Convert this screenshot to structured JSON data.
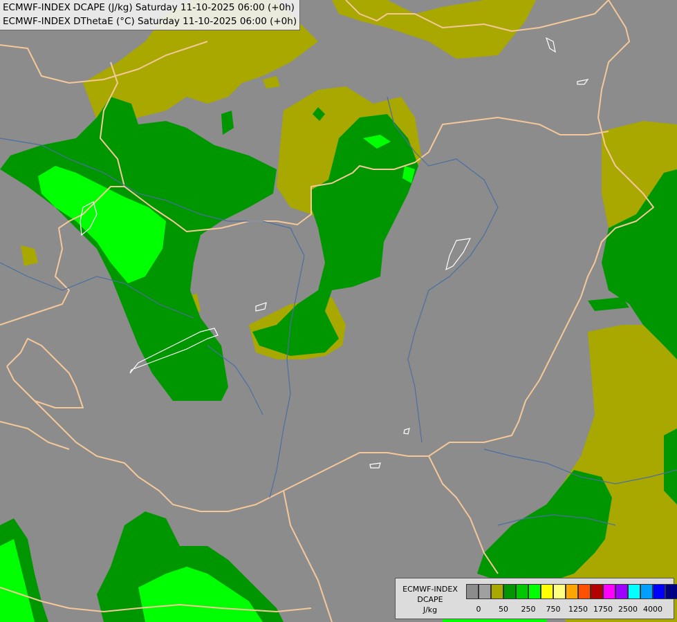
{
  "title": {
    "line1": "ECMWF-INDEX DCAPE (J/kg) Saturday 11-10-2025 06:00 (+0h)",
    "line2": "ECMWF-INDEX DThetaE (°C) Saturday 11-10-2025 06:00 (+0h)"
  },
  "legend": {
    "name": "ECMWF-INDEX",
    "variable": "DCAPE",
    "unit": "J/kg",
    "colors": [
      "#8c8c8c",
      "#a0a0a0",
      "#a8a800",
      "#009600",
      "#00c800",
      "#00ff00",
      "#ffff00",
      "#ffff80",
      "#ffa500",
      "#ff5000",
      "#b40000",
      "#ff00ff",
      "#a000ff",
      "#00ffff",
      "#00a0ff",
      "#0000ff",
      "#000080"
    ],
    "ticks": [
      "0",
      "50",
      "250",
      "750",
      "1250",
      "1750",
      "2500",
      "4000"
    ]
  },
  "palette": {
    "background": "#8c8c8c",
    "olive": "#a8a800",
    "green": "#009600",
    "lime": "#00ff00",
    "border": "#f5c89a",
    "river": "#4a6fa0",
    "lake": "#ffffff"
  }
}
